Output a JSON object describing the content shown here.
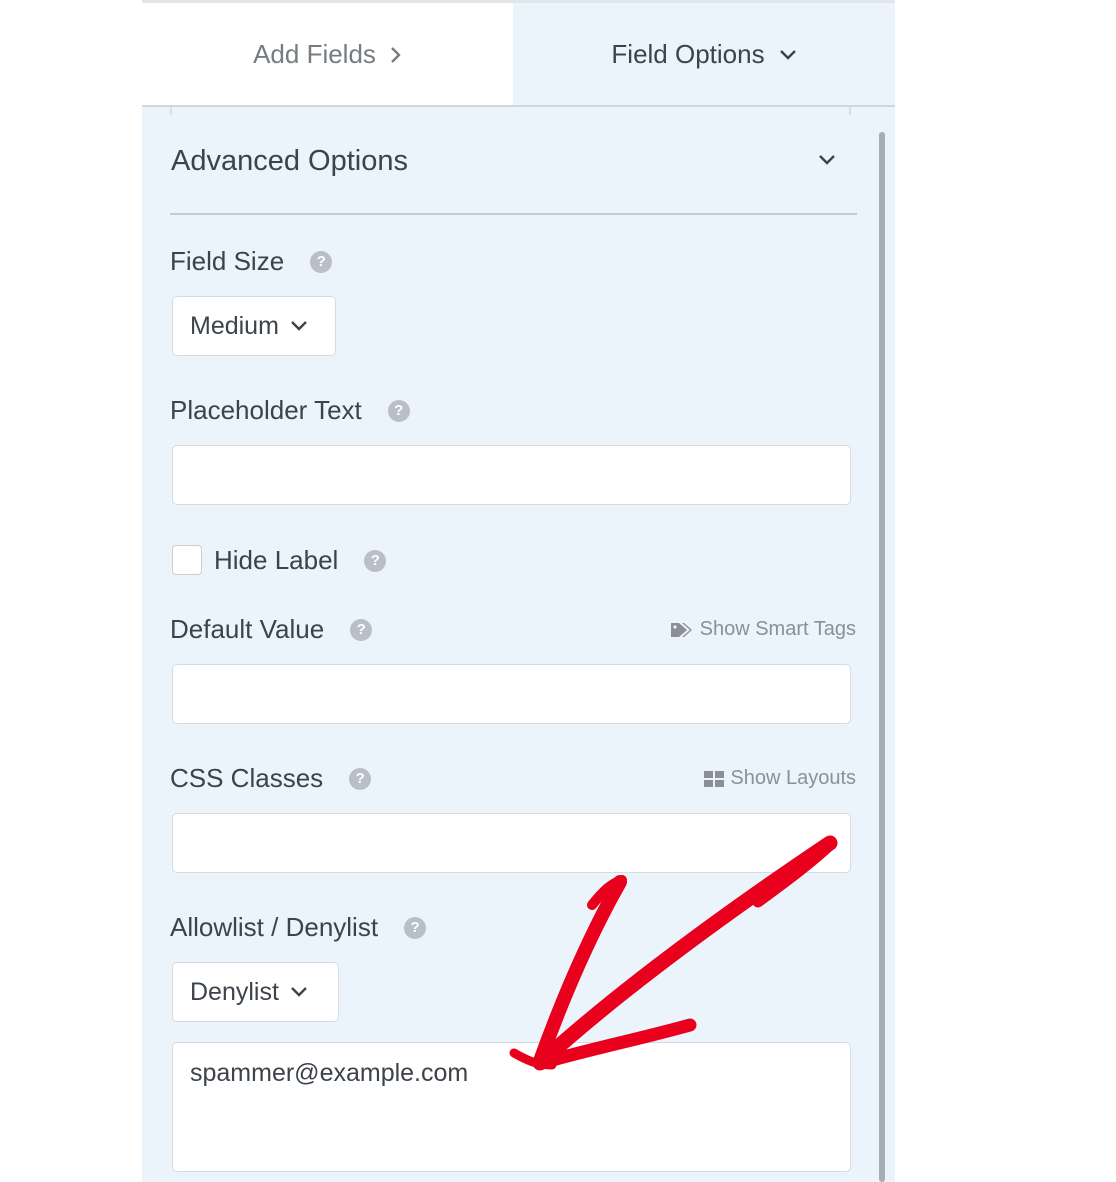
{
  "tabs": {
    "add_fields": "Add Fields",
    "field_options": "Field Options"
  },
  "section": {
    "title": "Advanced Options"
  },
  "fields": {
    "field_size": {
      "label": "Field Size",
      "value": "Medium"
    },
    "placeholder_text": {
      "label": "Placeholder Text",
      "value": ""
    },
    "hide_label": {
      "label": "Hide Label",
      "checked": false
    },
    "default_value": {
      "label": "Default Value",
      "value": "",
      "side_link": "Show Smart Tags"
    },
    "css_classes": {
      "label": "CSS Classes",
      "value": "",
      "side_link": "Show Layouts"
    },
    "allow_deny": {
      "label": "Allowlist / Denylist",
      "value": "Denylist",
      "textarea_value": "spammer@example.com"
    }
  },
  "help_glyph": "?",
  "colors": {
    "panel_bg": "#ebf3fb",
    "annotation_arrow": "#e8001c"
  },
  "icons": [
    "chevron-right-icon",
    "chevron-down-icon",
    "help-icon",
    "tag-icon",
    "grid-icon",
    "annotation-arrow"
  ]
}
